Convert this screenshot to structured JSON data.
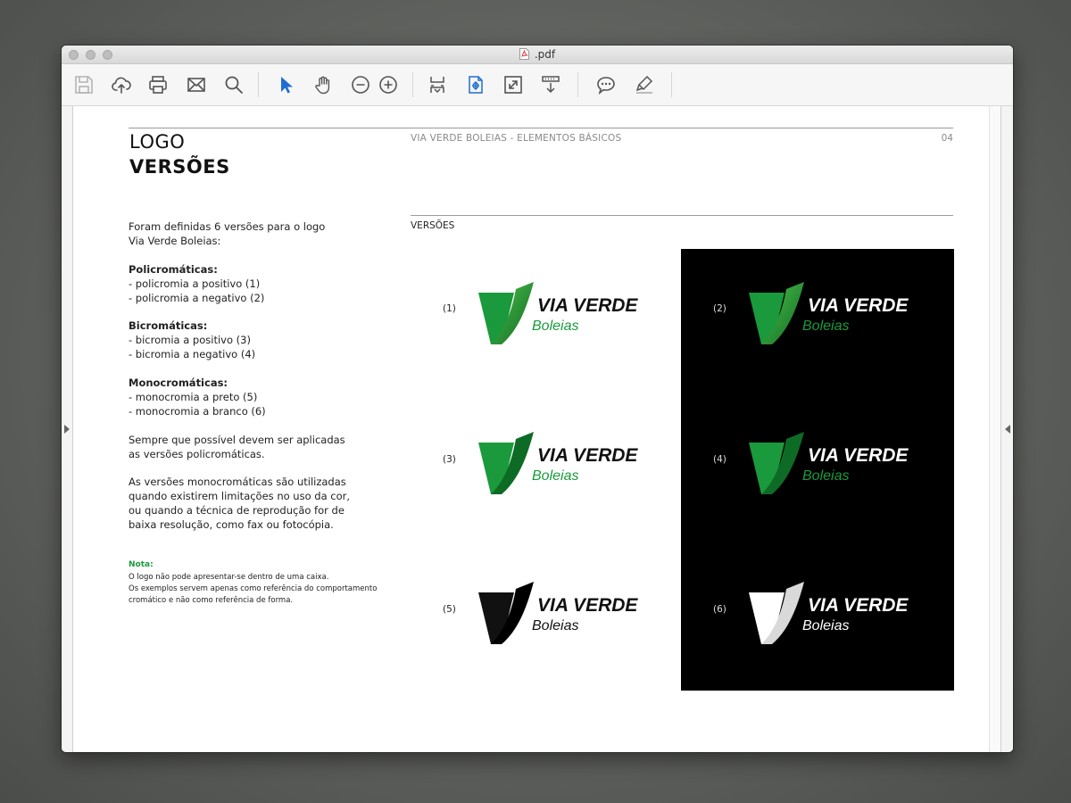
{
  "window": {
    "title": ".pdf"
  },
  "toolbar": {
    "buttons": [
      {
        "name": "save-icon"
      },
      {
        "name": "cloud-upload-icon"
      },
      {
        "name": "print-icon"
      },
      {
        "name": "mail-icon"
      },
      {
        "name": "search-icon"
      },
      {
        "name": "select-cursor-icon"
      },
      {
        "name": "hand-icon"
      },
      {
        "name": "zoom-out-icon"
      },
      {
        "name": "zoom-in-icon"
      },
      {
        "name": "fit-page-icon"
      },
      {
        "name": "fit-width-icon"
      },
      {
        "name": "fullscreen-icon"
      },
      {
        "name": "scroll-mode-icon"
      },
      {
        "name": "comment-icon"
      },
      {
        "name": "highlight-icon"
      }
    ],
    "active_color": "#1f6fd1"
  },
  "page": {
    "heading_line1": "LOGO",
    "heading_line2": "VERSÕES",
    "running_header": "VIA VERDE BOLEIAS - ELEMENTOS BÁSICOS",
    "page_number": "04",
    "section_label": "VERSÕES",
    "intro_lines": [
      "Foram definidas 6 versões para o logo",
      "Via Verde Boleias:"
    ],
    "groups": [
      {
        "title": "Policromáticas:",
        "items": [
          "- policromia a positivo (1)",
          "- policromia a negativo (2)"
        ]
      },
      {
        "title": "Bicromáticas:",
        "items": [
          "- bicromia a positivo (3)",
          "- bicromia a negativo (4)"
        ]
      },
      {
        "title": "Monocromáticas:",
        "items": [
          "- monocromia a preto (5)",
          "- monocromia a branco (6)"
        ]
      }
    ],
    "para1": [
      "Sempre que possível devem ser aplicadas",
      "as versões policromáticas."
    ],
    "para2": [
      "As versões monocromáticas são utilizadas",
      "quando existirem limitações no uso da cor,",
      "ou quando a técnica de reprodução for de",
      "baixa resolução, como fax ou fotocópia."
    ],
    "nota_title": "Nota:",
    "nota_lines": [
      "O logo não pode apresentar-se dentro de uma caixa.",
      "Os exemplos servem apenas como referência do comportamento",
      "cromático e não como referência de forma."
    ]
  },
  "logo": {
    "line1": "VIA VERDE",
    "line2": "Boleias"
  },
  "versions": [
    {
      "label": "(1)",
      "variant": "poly",
      "background": "white"
    },
    {
      "label": "(2)",
      "variant": "poly",
      "background": "black"
    },
    {
      "label": "(3)",
      "variant": "bi",
      "background": "white"
    },
    {
      "label": "(4)",
      "variant": "bi",
      "background": "black"
    },
    {
      "label": "(5)",
      "variant": "mono-black",
      "background": "white"
    },
    {
      "label": "(6)",
      "variant": "mono-white",
      "background": "black"
    }
  ],
  "colors": {
    "brand_green": "#1a9a3c",
    "brand_green_dark": "#0e6b25",
    "brand_green_light": "#4fc04a",
    "nota_green": "#1a9a3c"
  }
}
